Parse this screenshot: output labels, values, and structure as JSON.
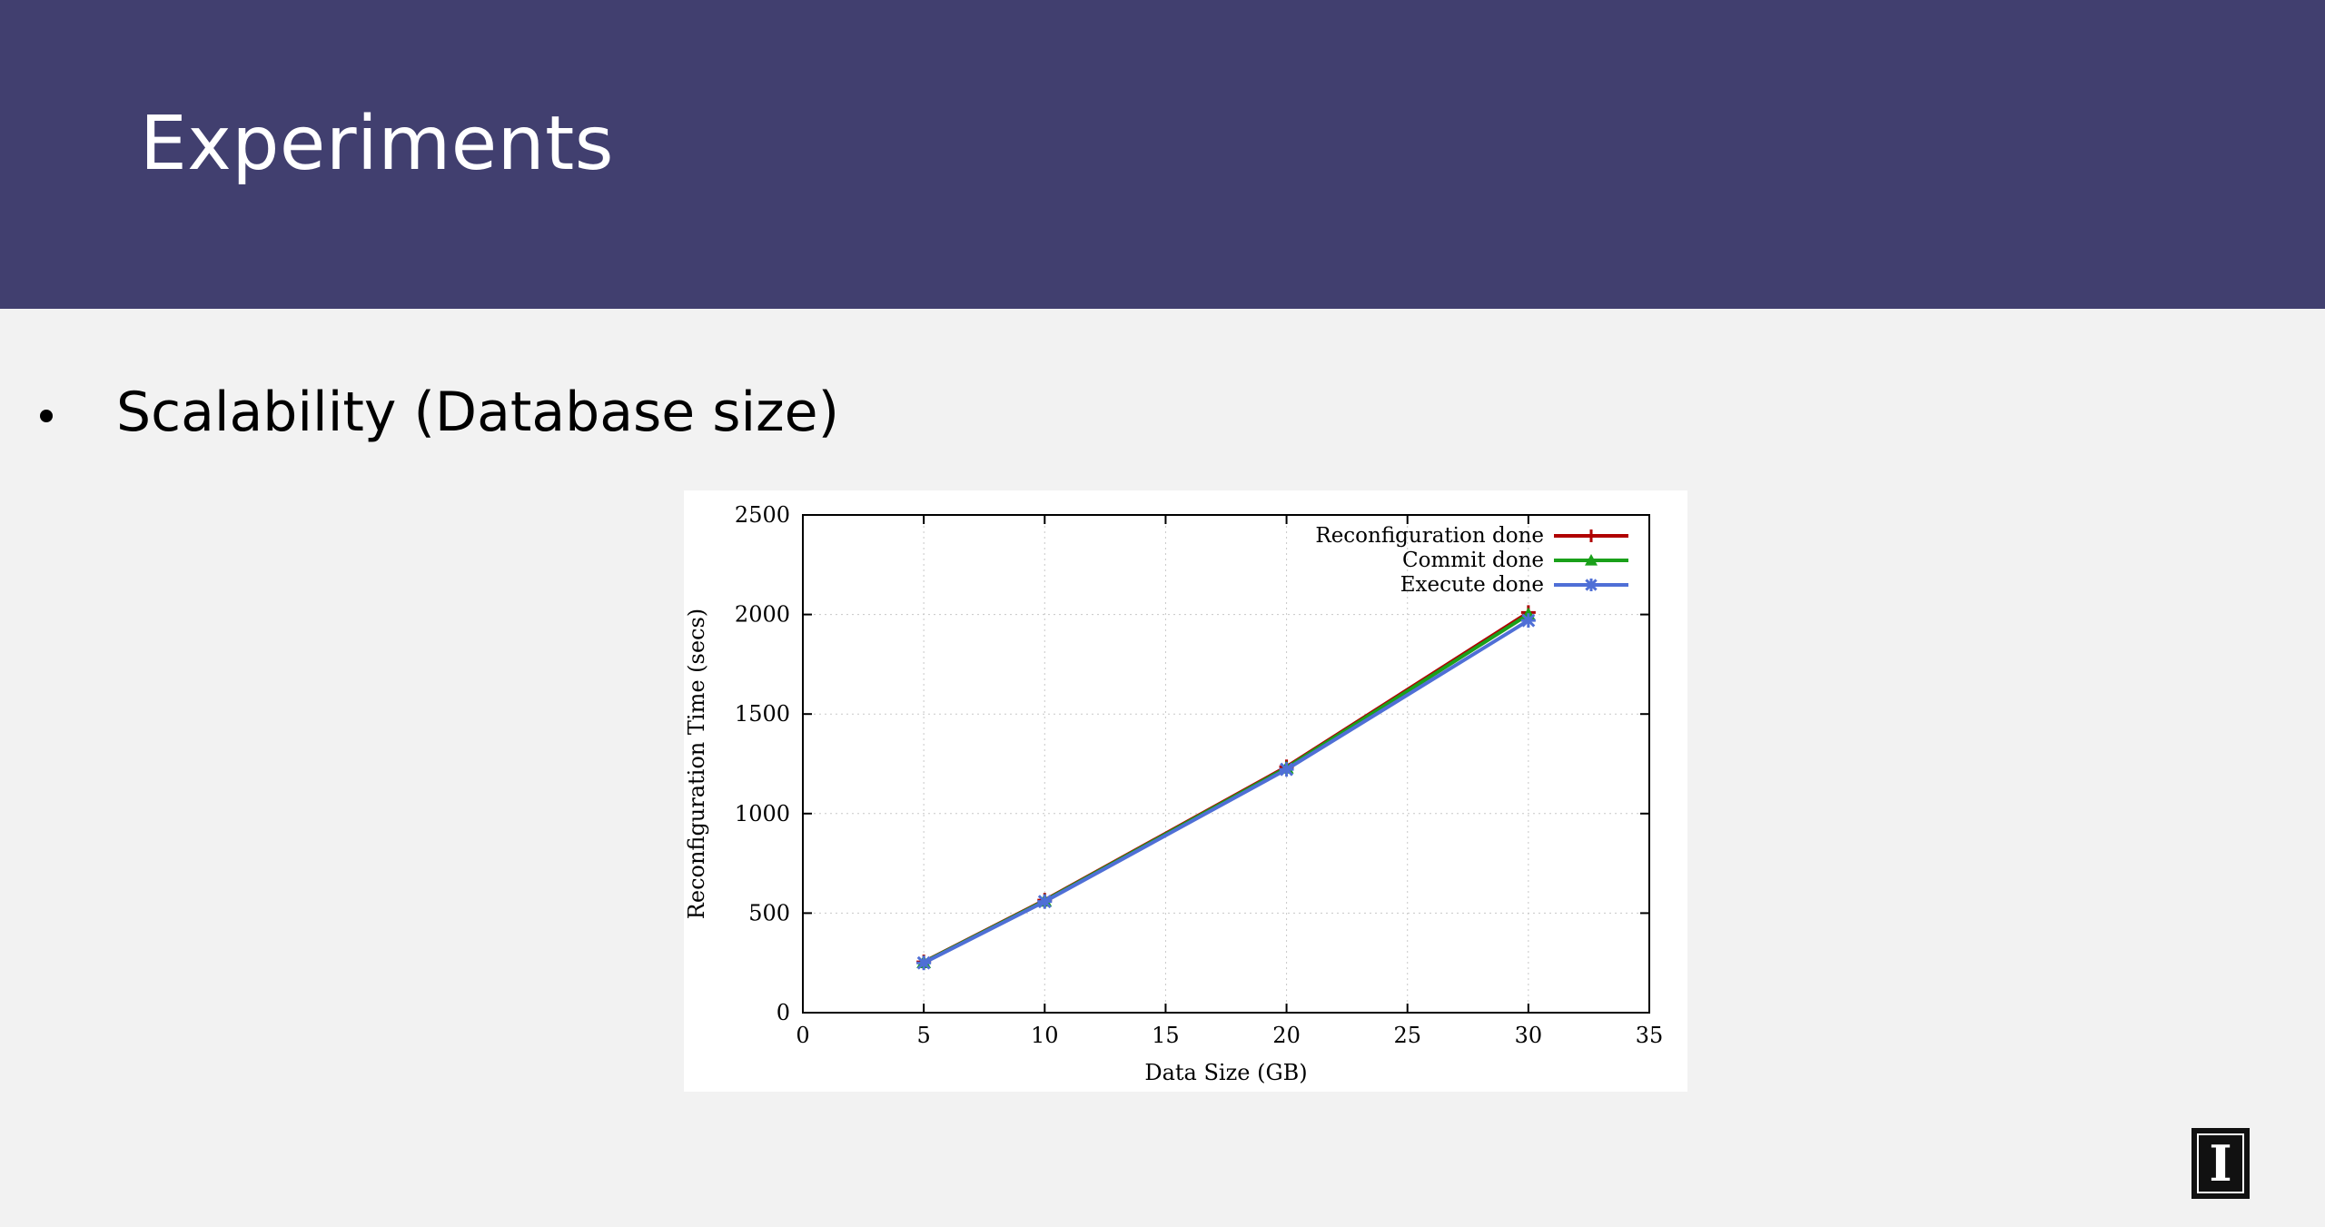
{
  "slide": {
    "title": "Experiments",
    "bullet": "Scalability (Database size)",
    "logo_text": "I"
  },
  "colors": {
    "header": "#413f6f",
    "background": "#f2f2f2",
    "series_reconfiguration": "#b00000",
    "series_commit": "#1aa01a",
    "series_execute": "#4f6fd6"
  },
  "chart_data": {
    "type": "line",
    "title": "",
    "xlabel": "Data Size (GB)",
    "ylabel": "Reconfiguration Time (secs)",
    "xlim": [
      0,
      35
    ],
    "ylim": [
      0,
      2500
    ],
    "xticks": [
      0,
      5,
      10,
      15,
      20,
      25,
      30,
      35
    ],
    "yticks": [
      0,
      500,
      1000,
      1500,
      2000,
      2500
    ],
    "grid": true,
    "legend": "top-right",
    "x": [
      5,
      10,
      20,
      30
    ],
    "series": [
      {
        "name": "Reconfiguration done",
        "values": [
          255,
          565,
          1235,
          2010
        ],
        "color": "#b00000",
        "marker": "plus"
      },
      {
        "name": "Commit done",
        "values": [
          253,
          562,
          1230,
          2000
        ],
        "color": "#1aa01a",
        "marker": "triangle"
      },
      {
        "name": "Execute done",
        "values": [
          250,
          558,
          1222,
          1970
        ],
        "color": "#4f6fd6",
        "marker": "star"
      }
    ]
  }
}
